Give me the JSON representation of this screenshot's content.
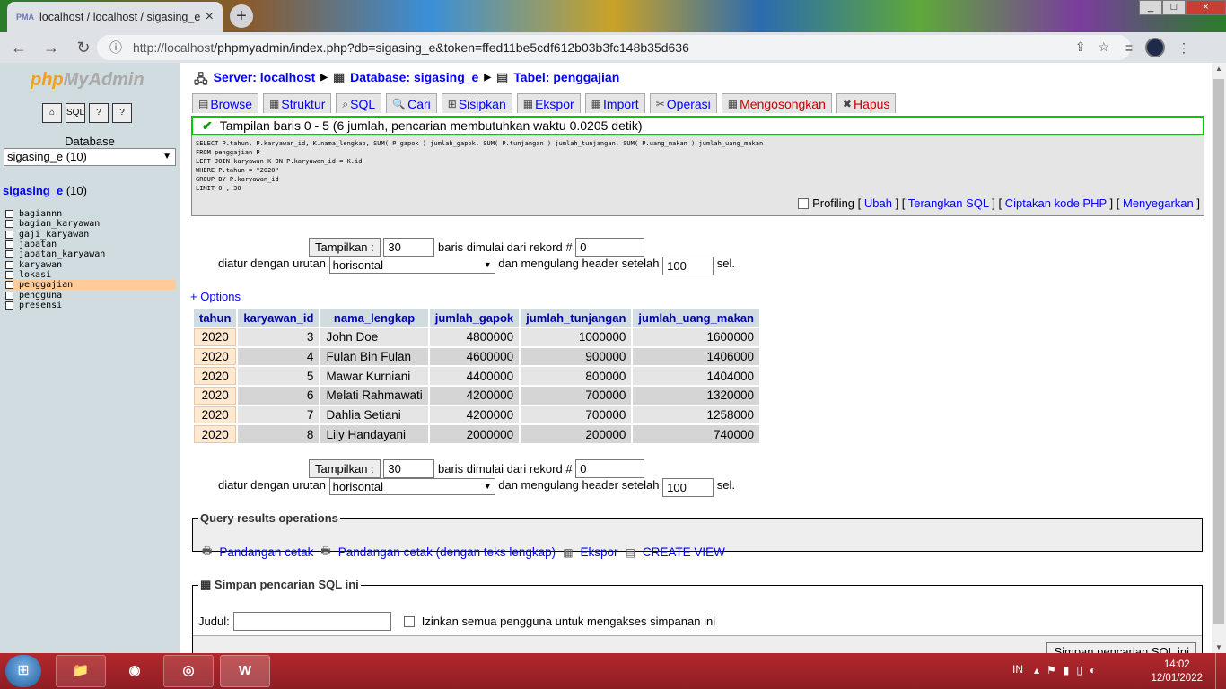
{
  "browser": {
    "tab_title": "localhost / localhost / sigasing_e",
    "favicon_text": "PMA",
    "url_prefix": "http://localhost",
    "url_rest": "/phpmyadmin/index.php?db=sigasing_e&token=ffed11be5cdf612b03b3fc148b35d636"
  },
  "sidebar": {
    "logo_php": "php",
    "logo_rest": "MyAdmin",
    "database_label": "Database",
    "db_select_value": "sigasing_e (10)",
    "db_name": "sigasing_e",
    "db_count": "(10)",
    "tables": [
      "bagiannn",
      "bagian_karyawan",
      "gaji_karyawan",
      "jabatan",
      "jabatan_karyawan",
      "karyawan",
      "lokasi",
      "penggajian",
      "pengguna",
      "presensi"
    ],
    "selected_table": "penggajian"
  },
  "breadcrumb": {
    "server": "Server: localhost",
    "database": "Database: sigasing_e",
    "table": "Tabel: penggajian"
  },
  "tabs": {
    "browse": "Browse",
    "struktur": "Struktur",
    "sql": "SQL",
    "cari": "Cari",
    "sisipkan": "Sisipkan",
    "ekspor": "Ekspor",
    "import": "Import",
    "operasi": "Operasi",
    "mengosongkan": "Mengosongkan",
    "hapus": "Hapus"
  },
  "notice": "Tampilan baris 0 - 5 (6 jumlah, pencarian membutuhkan waktu 0.0205 detik)",
  "sql": {
    "line1": "SELECT P.tahun, P.karyawan_id, K.nama_lengkap, SUM( P.gapok ) jumlah_gapok, SUM( P.tunjangan ) jumlah_tunjangan, SUM( P.uang_makan ) jumlah_uang_makan",
    "line2": "FROM penggajian P",
    "line3": "LEFT JOIN karyawan K ON P.karyawan_id = K.id",
    "line4": "WHERE P.tahun = \"2020\"",
    "line5": "GROUP BY P.karyawan_id",
    "line6": "LIMIT 0 , 30"
  },
  "sql_links": {
    "profiling": "Profiling",
    "ubah": "Ubah",
    "terangkan": "Terangkan SQL",
    "ciptakan": "Ciptakan kode PHP",
    "menyegarkan": "Menyegarkan"
  },
  "nav": {
    "tampilkan": "Tampilkan :",
    "rows": "30",
    "baris_mulai": "baris dimulai dari rekord #",
    "start": "0",
    "diatur": "diatur dengan urutan",
    "mode": "horisontal",
    "mengulang": "dan mengulang header setelah",
    "repeat": "100",
    "sel": "sel."
  },
  "options_link": "+ Options",
  "table": {
    "headers": [
      "tahun",
      "karyawan_id",
      "nama_lengkap",
      "jumlah_gapok",
      "jumlah_tunjangan",
      "jumlah_uang_makan"
    ],
    "rows": [
      [
        "2020",
        "3",
        "John Doe",
        "4800000",
        "1000000",
        "1600000"
      ],
      [
        "2020",
        "4",
        "Fulan Bin Fulan",
        "4600000",
        "900000",
        "1406000"
      ],
      [
        "2020",
        "5",
        "Mawar Kurniani",
        "4400000",
        "800000",
        "1404000"
      ],
      [
        "2020",
        "6",
        "Melati Rahmawati",
        "4200000",
        "700000",
        "1320000"
      ],
      [
        "2020",
        "7",
        "Dahlia Setiani",
        "4200000",
        "700000",
        "1258000"
      ],
      [
        "2020",
        "8",
        "Lily Handayani",
        "2000000",
        "200000",
        "740000"
      ]
    ]
  },
  "qro": {
    "legend": "Query results operations",
    "cetak": "Pandangan cetak",
    "cetak_lengkap": "Pandangan cetak (dengan teks lengkap)",
    "ekspor": "Ekspor",
    "create_view": "CREATE VIEW"
  },
  "simpan": {
    "legend": "Simpan pencarian SQL ini",
    "judul": "Judul:",
    "izinkan": "Izinkan semua pengguna untuk mengakses simpanan ini",
    "button": "Simpan pencarian SQL ini"
  },
  "taskbar": {
    "lang": "IN",
    "time": "14:02",
    "date": "12/01/2022",
    "word_label": "W"
  }
}
